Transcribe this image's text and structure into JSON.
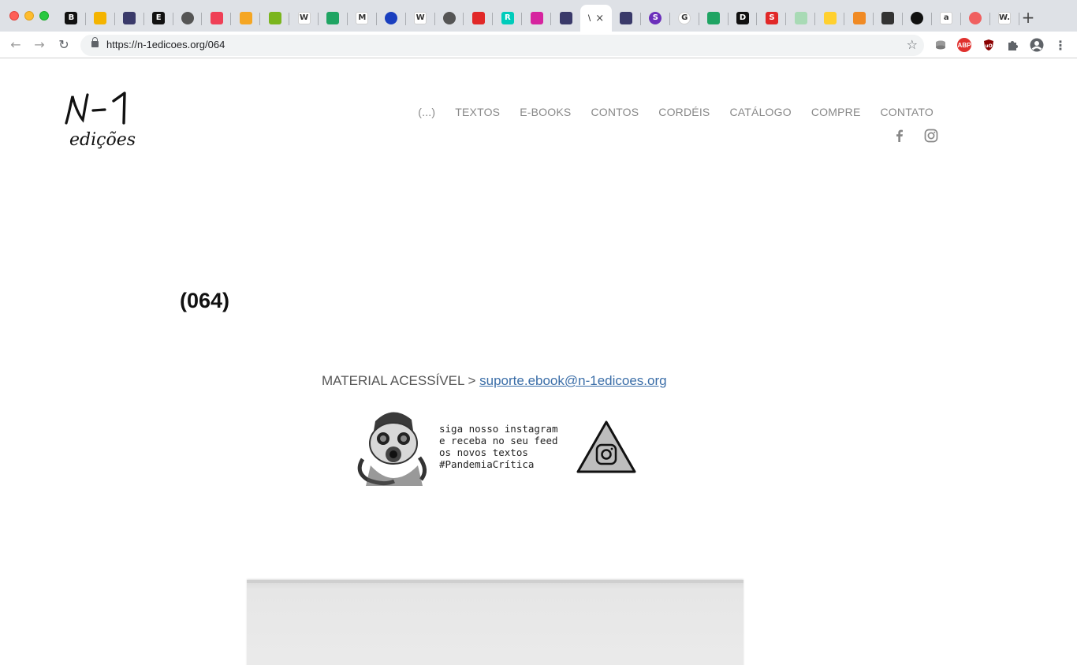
{
  "browser": {
    "url": "https://n-1edicoes.org/064",
    "active_tab_title": "\\"
  },
  "tabs": [
    {
      "icon": "b-icon",
      "letter": "B",
      "color": "#111111"
    },
    {
      "icon": "slides-icon",
      "letter": "",
      "color": "#f4b400"
    },
    {
      "icon": "n1-logo-icon",
      "letter": "",
      "color": "#3a3a6a"
    },
    {
      "icon": "e-icon",
      "letter": "E",
      "color": "#111111"
    },
    {
      "icon": "globe-icon",
      "letter": "",
      "color": "#555555"
    },
    {
      "icon": "pocket-icon",
      "letter": "",
      "color": "#ef3f56"
    },
    {
      "icon": "link-icon",
      "letter": "",
      "color": "#f5a623"
    },
    {
      "icon": "bookmark-icon",
      "letter": "",
      "color": "#7ab51d"
    },
    {
      "icon": "wikipedia-icon",
      "letter": "W",
      "color": "#ffffff"
    },
    {
      "icon": "drive-icon",
      "letter": "",
      "color": "#1fa463"
    },
    {
      "icon": "medium-icon",
      "letter": "M",
      "color": "#ffffff"
    },
    {
      "icon": "blue-dot-icon",
      "letter": "",
      "color": "#1a3fbf"
    },
    {
      "icon": "wikipedia-icon",
      "letter": "W",
      "color": "#ffffff"
    },
    {
      "icon": "globe-icon",
      "letter": "",
      "color": "#555555"
    },
    {
      "icon": "flipboard-icon",
      "letter": "",
      "color": "#e12828"
    },
    {
      "icon": "researchgate-icon",
      "letter": "R",
      "color": "#00ccbb"
    },
    {
      "icon": "instagram-icon",
      "letter": "",
      "color": "#d6249f"
    },
    {
      "icon": "n1-logo-icon",
      "letter": "",
      "color": "#3a3a6a"
    },
    {
      "icon": "n1-logo-icon",
      "letter": "",
      "color": "#3a3a6a"
    },
    {
      "icon": "s-circle-icon",
      "letter": "S",
      "color": "#6b2fbb"
    },
    {
      "icon": "google-icon",
      "letter": "G",
      "color": "#ffffff"
    },
    {
      "icon": "drive-icon",
      "letter": "",
      "color": "#1fa463"
    },
    {
      "icon": "d-icon",
      "letter": "D",
      "color": "#111111"
    },
    {
      "icon": "s-red-icon",
      "letter": "S",
      "color": "#e12828"
    },
    {
      "icon": "sheets-icon",
      "letter": "",
      "color": "#a8dab5"
    },
    {
      "icon": "miro-icon",
      "letter": "",
      "color": "#ffd02f"
    },
    {
      "icon": "orange-grid-icon",
      "letter": "",
      "color": "#f08a24"
    },
    {
      "icon": "diamond-icon",
      "letter": "",
      "color": "#333333"
    },
    {
      "icon": "dark-circle-icon",
      "letter": "",
      "color": "#111111"
    },
    {
      "icon": "amazon-icon",
      "letter": "a",
      "color": "#ffffff"
    },
    {
      "icon": "target-icon",
      "letter": "",
      "color": "#f06060"
    },
    {
      "icon": "w-icon",
      "letter": "W.",
      "color": "#ffffff"
    }
  ],
  "page": {
    "brand": {
      "line1": "N-1",
      "line2": "edições"
    },
    "nav": [
      "(...)",
      "TEXTOS",
      "E-BOOKS",
      "CONTOS",
      "CORDÉIS",
      "CATÁLOGO",
      "COMPRE",
      "CONTATO"
    ],
    "title": "(064)",
    "access_label": "MATERIAL ACESSÍVEL > ",
    "access_email": "suporte.ebook@n-1edicoes.org",
    "promo_text": "siga nosso instagram\ne receba no seu feed\nos novos textos\n#PandemiaCrítica"
  }
}
